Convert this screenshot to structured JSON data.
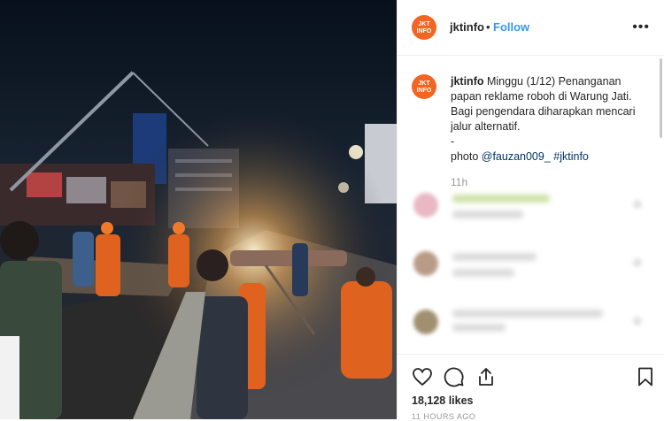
{
  "post": {
    "photo_alt": "Night scene: officers in orange uniforms handling a collapsed billboard on a road",
    "avatar_text": "JKT INFO",
    "username": "jktinfo",
    "separator": "•",
    "follow_label": "Follow",
    "more_label": "•••"
  },
  "caption": {
    "username": "jktinfo",
    "text": "Minggu (1/12) Penanganan papan reklame roboh di Warung Jati. Bagi pengendara diharapkan mencari jalur alternatif.",
    "dash": "-",
    "photo_prefix": "photo",
    "mention": "@fauzan009_",
    "hashtag": "#jktinfo",
    "time": "11h"
  },
  "stats": {
    "likes": "18,128 likes",
    "posted_ago": "11 HOURS AGO"
  },
  "colors": {
    "brand": "#f26522",
    "link": "#3897f0",
    "tag": "#003569"
  },
  "icons": [
    "heart-icon",
    "comment-icon",
    "share-icon",
    "bookmark-icon"
  ]
}
